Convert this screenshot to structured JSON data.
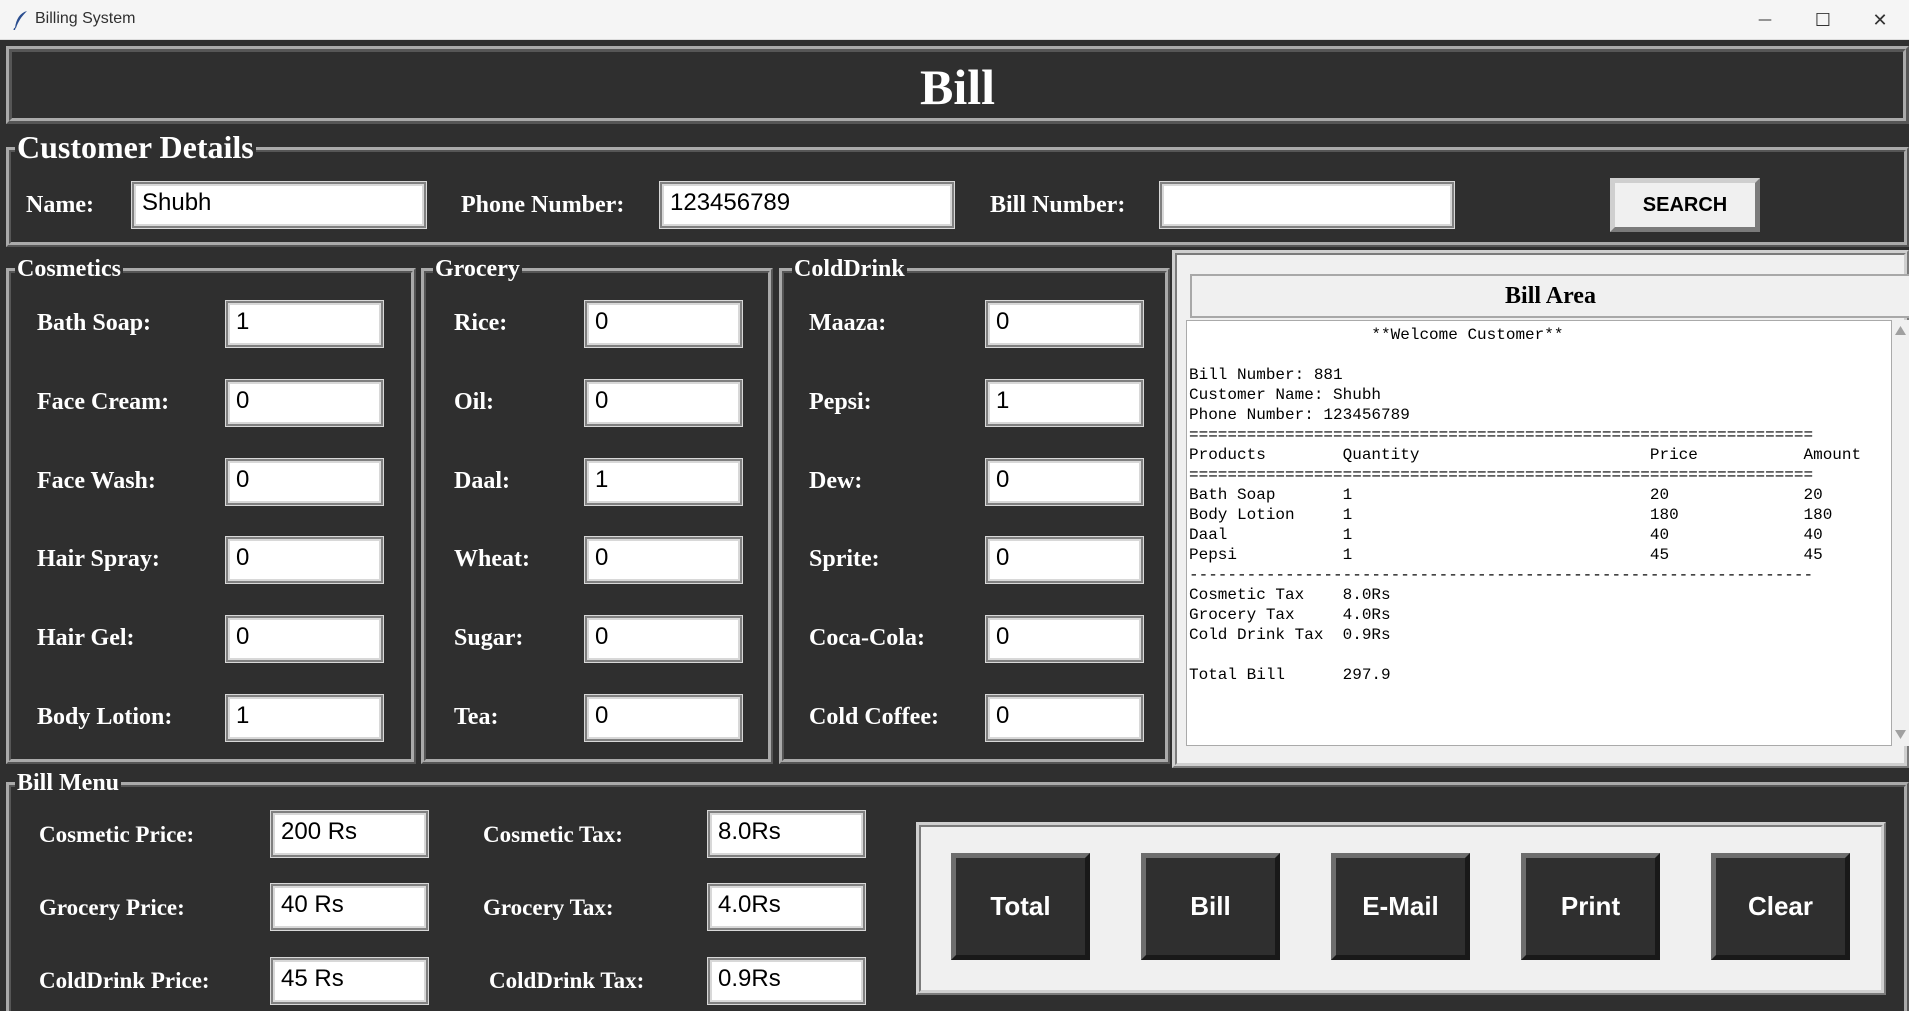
{
  "window": {
    "title": "Billing System",
    "minimize_glyph": "—",
    "maximize_glyph": "☐",
    "close_glyph": "✕"
  },
  "header": {
    "title": "Bill"
  },
  "customer": {
    "legend": "Customer Details",
    "name_label": "Name:",
    "name_value": "Shubh",
    "phone_label": "Phone Number:",
    "phone_value": "123456789",
    "bill_label": "Bill Number:",
    "bill_value": "",
    "search_label": "SEARCH"
  },
  "cosmetics": {
    "legend": "Cosmetics",
    "items": [
      {
        "label": "Bath Soap:",
        "value": "1"
      },
      {
        "label": "Face Cream:",
        "value": "0"
      },
      {
        "label": "Face Wash:",
        "value": "0"
      },
      {
        "label": "Hair Spray:",
        "value": "0"
      },
      {
        "label": "Hair Gel:",
        "value": "0"
      },
      {
        "label": "Body Lotion:",
        "value": "1"
      }
    ]
  },
  "grocery": {
    "legend": "Grocery",
    "items": [
      {
        "label": "Rice:",
        "value": "0"
      },
      {
        "label": "Oil:",
        "value": "0"
      },
      {
        "label": "Daal:",
        "value": "1"
      },
      {
        "label": "Wheat:",
        "value": "0"
      },
      {
        "label": "Sugar:",
        "value": "0"
      },
      {
        "label": "Tea:",
        "value": "0"
      }
    ]
  },
  "colddrink": {
    "legend": "ColdDrink",
    "items": [
      {
        "label": "Maaza:",
        "value": "0"
      },
      {
        "label": "Pepsi:",
        "value": "1"
      },
      {
        "label": "Dew:",
        "value": "0"
      },
      {
        "label": "Sprite:",
        "value": "0"
      },
      {
        "label": "Coca-Cola:",
        "value": "0"
      },
      {
        "label": "Cold Coffee:",
        "value": "0"
      }
    ]
  },
  "bill_area": {
    "title": "Bill Area",
    "lines": [
      "                   **Welcome Customer**",
      "",
      "Bill Number: 881",
      "Customer Name: Shubh",
      "Phone Number: 123456789",
      "=================================================================",
      "Products        Quantity                        Price           Amount",
      "=================================================================",
      "Bath Soap       1                               20              20",
      "Body Lotion     1                               180             180",
      "Daal            1                               40              40",
      "Pepsi           1                               45              45",
      "-----------------------------------------------------------------",
      "Cosmetic Tax    8.0Rs",
      "Grocery Tax     4.0Rs",
      "Cold Drink Tax  0.9Rs",
      "",
      "Total Bill      297.9"
    ]
  },
  "bill_menu": {
    "legend": "Bill Menu",
    "cosmetic_price_label": "Cosmetic Price:",
    "cosmetic_price_value": "200 Rs",
    "grocery_price_label": "Grocery Price:",
    "grocery_price_value": "40 Rs",
    "colddrink_price_label": "ColdDrink Price:",
    "colddrink_price_value": "45 Rs",
    "cosmetic_tax_label": "Cosmetic Tax:",
    "cosmetic_tax_value": "8.0Rs",
    "grocery_tax_label": "Grocery Tax:",
    "grocery_tax_value": "4.0Rs",
    "colddrink_tax_label": "ColdDrink Tax:",
    "colddrink_tax_value": "0.9Rs",
    "buttons": [
      "Total",
      "Bill",
      "E-Mail",
      "Print",
      "Clear"
    ]
  },
  "icons": {
    "app": "feather-icon",
    "scroll_up": "scroll-up-arrow-icon",
    "scroll_down": "scroll-down-arrow-icon"
  }
}
